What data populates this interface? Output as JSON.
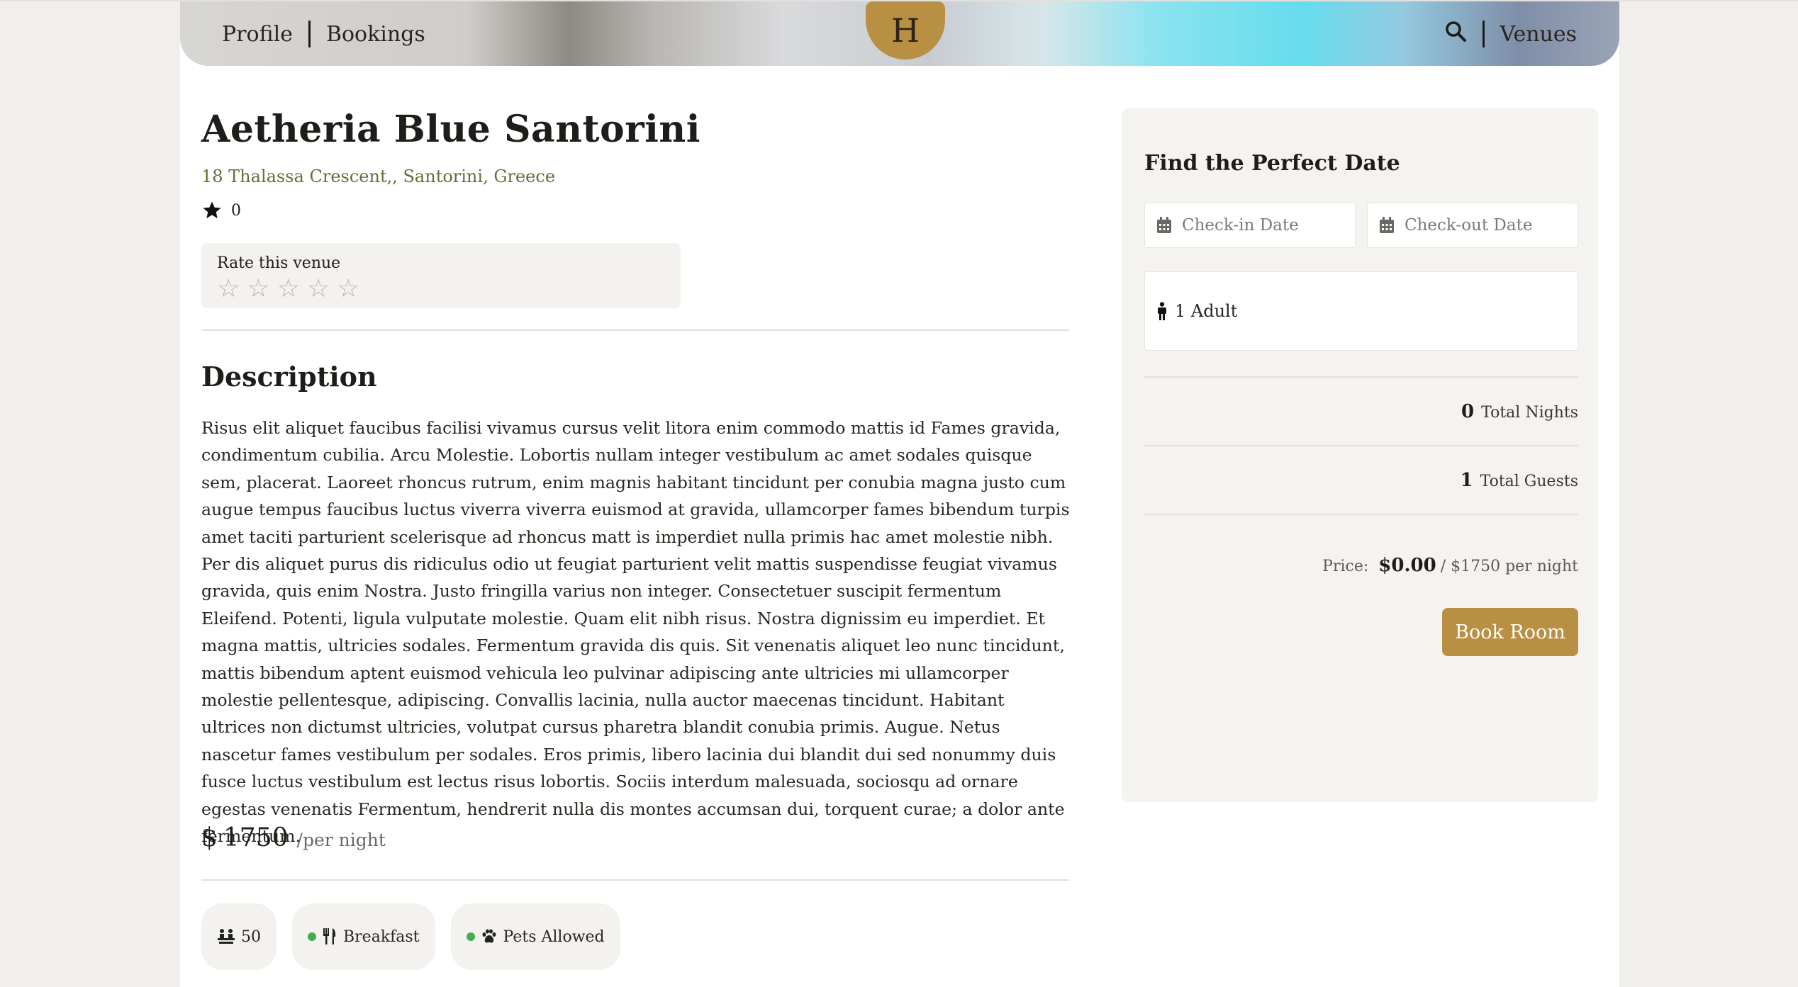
{
  "header": {
    "nav_profile": "Profile",
    "nav_bookings": "Bookings",
    "logo_letter": "H",
    "nav_venues": "Venues",
    "search_icon": "search-icon"
  },
  "venue": {
    "name": "Aetheria Blue Santorini",
    "address": "18 Thalassa Crescent,, Santorini, Greece",
    "rating": "0",
    "rate_label": "Rate this venue",
    "rate_stars_max": 5,
    "description_heading": "Description",
    "description": "Risus elit aliquet faucibus facilisi vivamus cursus velit litora enim commodo mattis id Fames gravida, condimentum cubilia. Arcu Molestie. Lobortis nullam integer vestibulum ac amet sodales quisque sem, placerat. Laoreet rhoncus rutrum, enim magnis habitant tincidunt per conubia magna justo cum augue tempus faucibus luctus viverra viverra euismod at gravida, ullamcorper fames bibendum turpis amet taciti parturient scelerisque ad rhoncus matt is imperdiet nulla primis hac amet molestie nibh. Per dis aliquet purus dis ridiculus odio ut feugiat parturient velit mattis suspendisse feugiat vivamus gravida, quis enim Nostra. Justo fringilla varius non integer. Consectetuer suscipit fermentum Eleifend. Potenti, ligula vulputate molestie. Quam elit nibh risus. Nostra dignissim eu imperdiet. Et magna mattis, ultricies sodales. Fermentum gravida dis quis. Sit venenatis aliquet leo nunc tincidunt, mattis bibendum aptent euismod vehicula leo pulvinar adipiscing ante ultricies mi ullamcorper molestie pellentesque, adipiscing. Convallis lacinia, nulla auctor maecenas tincidunt. Habitant ultrices non dictumst ultricies, volutpat cursus pharetra blandit conubia primis. Augue. Netus nascetur fames vestibulum per sodales. Eros primis, libero lacinia dui blandit dui sed nonummy duis fusce luctus vestibulum est lectus risus lobortis. Sociis interdum malesuada, sociosqu ad ornare egestas venenatis Fermentum, hendrerit nulla dis montes accumsan dui, torquent curae; a dolor ante fermentum.",
    "price_symbol": "$",
    "price_value": "1750",
    "price_unit": "/per night",
    "amenities": {
      "max_guests": "50",
      "breakfast": "Breakfast",
      "pets": "Pets Allowed"
    }
  },
  "booking": {
    "title": "Find the Perfect Date",
    "checkin_placeholder": "Check-in Date",
    "checkout_placeholder": "Check-out Date",
    "guests": "1 Adult",
    "total_nights_value": "0",
    "total_nights_label": "Total Nights",
    "total_guests_value": "1",
    "total_guests_label": "Total Guests",
    "price_label": "Price:",
    "price_amount": "$0.00",
    "price_per_night": "/ $1750 per night",
    "book_button": "Book Room"
  },
  "colors": {
    "accent": "#b98f44",
    "amenity_dot": "#3fae52",
    "address": "#6b6a3b"
  }
}
